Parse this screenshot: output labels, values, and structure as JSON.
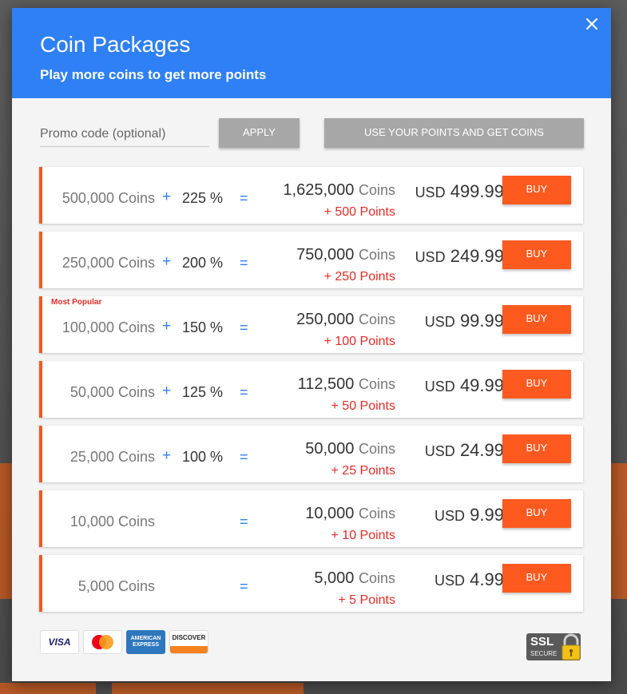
{
  "modal": {
    "title": "Coin Packages",
    "subtitle": "Play more coins to get more points",
    "close_icon": "close-icon"
  },
  "promo": {
    "placeholder": "Promo code (optional)",
    "apply_label": "APPLY",
    "points_label": "USE YOUR POINTS AND GET COINS"
  },
  "packages": [
    {
      "base": "500,000 Coins",
      "plus": "+",
      "bonus_pct": "225 %",
      "equals": "=",
      "total": "1,625,000",
      "total_unit": "Coins",
      "points": "+ 500 Points",
      "currency": "USD",
      "price": "499.99",
      "buy_label": "BUY"
    },
    {
      "base": "250,000 Coins",
      "plus": "+",
      "bonus_pct": "200 %",
      "equals": "=",
      "total": "750,000",
      "total_unit": "Coins",
      "points": "+ 250 Points",
      "currency": "USD",
      "price": "249.99",
      "buy_label": "BUY"
    },
    {
      "badge": "Most Popular",
      "base": "100,000 Coins",
      "plus": "+",
      "bonus_pct": "150 %",
      "equals": "=",
      "total": "250,000",
      "total_unit": "Coins",
      "points": "+ 100 Points",
      "currency": "USD",
      "price": "99.99",
      "buy_label": "BUY"
    },
    {
      "base": "50,000 Coins",
      "plus": "+",
      "bonus_pct": "125 %",
      "equals": "=",
      "total": "112,500",
      "total_unit": "Coins",
      "points": "+ 50 Points",
      "currency": "USD",
      "price": "49.99",
      "buy_label": "BUY"
    },
    {
      "base": "25,000 Coins",
      "plus": "+",
      "bonus_pct": "100 %",
      "equals": "=",
      "total": "50,000",
      "total_unit": "Coins",
      "points": "+ 25 Points",
      "currency": "USD",
      "price": "24.99",
      "buy_label": "BUY"
    },
    {
      "base": "10,000 Coins",
      "equals": "=",
      "total": "10,000",
      "total_unit": "Coins",
      "points": "+ 10 Points",
      "currency": "USD",
      "price": "9.99",
      "buy_label": "BUY"
    },
    {
      "base": "5,000 Coins",
      "equals": "=",
      "total": "5,000",
      "total_unit": "Coins",
      "points": "+ 5 Points",
      "currency": "USD",
      "price": "4.99",
      "buy_label": "BUY"
    }
  ],
  "payment_logos": [
    {
      "name": "visa-logo",
      "text": "VISA"
    },
    {
      "name": "mastercard-logo",
      "text": "MasterCard"
    },
    {
      "name": "amex-logo",
      "text": "AMERICAN EXPRESS"
    },
    {
      "name": "discover-logo",
      "text": "DISCOVER"
    }
  ],
  "ssl_badge": {
    "ssl": "SSL",
    "secure": "SECURE"
  },
  "colors": {
    "header_blue": "#2f80f5",
    "buy_orange": "#fe5a1f",
    "accent_border": "#ef5a24",
    "points_red": "#e32b25",
    "disabled_grey": "#a7a7a7"
  }
}
